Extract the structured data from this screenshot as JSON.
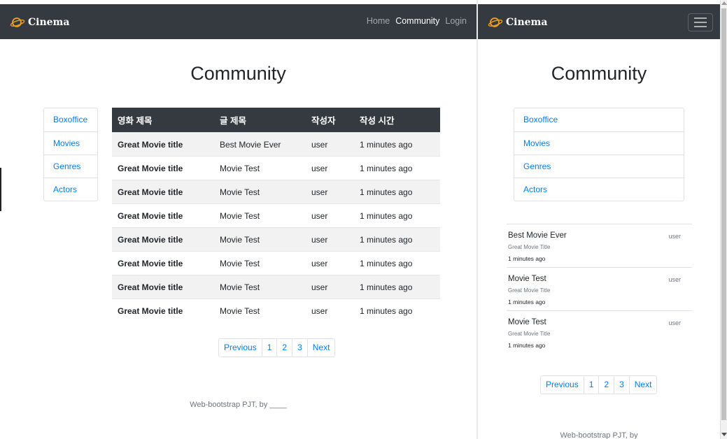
{
  "brand": {
    "name": "Cinema",
    "icon": "planet-logo-icon",
    "accent": "#f0a020"
  },
  "nav": {
    "links": [
      {
        "label": "Home"
      },
      {
        "label": "Community"
      },
      {
        "label": "Login"
      }
    ],
    "active": "Community"
  },
  "page": {
    "title": "Community"
  },
  "sidebar": {
    "items": [
      {
        "label": "Boxoffice"
      },
      {
        "label": "Movies"
      },
      {
        "label": "Genres"
      },
      {
        "label": "Actors"
      }
    ]
  },
  "table": {
    "headers": [
      "영화 제목",
      "글 제목",
      "작성자",
      "작성 시간"
    ],
    "rows": [
      [
        "Great Movie title",
        "Best Movie Ever",
        "user",
        "1 minutes ago"
      ],
      [
        "Great Movie title",
        "Movie Test",
        "user",
        "1 minutes ago"
      ],
      [
        "Great Movie title",
        "Movie Test",
        "user",
        "1 minutes ago"
      ],
      [
        "Great Movie title",
        "Movie Test",
        "user",
        "1 minutes ago"
      ],
      [
        "Great Movie title",
        "Movie Test",
        "user",
        "1 minutes ago"
      ],
      [
        "Great Movie title",
        "Movie Test",
        "user",
        "1 minutes ago"
      ],
      [
        "Great Movie title",
        "Movie Test",
        "user",
        "1 minutes ago"
      ],
      [
        "Great Movie title",
        "Movie Test",
        "user",
        "1 minutes ago"
      ]
    ]
  },
  "pagination": {
    "previous": "Previous",
    "pages": [
      "1",
      "2",
      "3"
    ],
    "next": "Next"
  },
  "footer": {
    "text": "Web-bootstrap PJT, by ____"
  },
  "mobile": {
    "footer_text": "Web-bootstrap PJT, by",
    "posts": [
      {
        "title": "Best Movie Ever",
        "movie": "Great Movie Title",
        "time": "1 minutes ago",
        "user": "user"
      },
      {
        "title": "Movie Test",
        "movie": "Great Movie Title",
        "time": "1 minutes ago",
        "user": "user"
      },
      {
        "title": "Movie Test",
        "movie": "Great Movie Title",
        "time": "1 minutes ago",
        "user": "user"
      }
    ]
  },
  "colors": {
    "navbar": "#343a40",
    "link": "#007bff",
    "striped_row": "#f2f2f2"
  }
}
